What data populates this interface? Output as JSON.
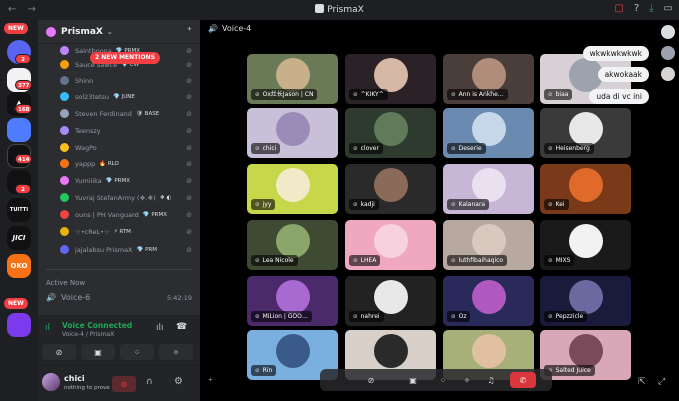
{
  "titlebar": {
    "title": "PrismaX",
    "nav": "← →",
    "ctrl_icons": [
      "▢",
      "?",
      "⤓",
      "▭"
    ]
  },
  "rail": {
    "badges": [
      {
        "type": "new",
        "text": "NEW"
      },
      {
        "type": "count",
        "text": "2"
      },
      {
        "type": "count",
        "text": "377"
      },
      {
        "type": "count",
        "text": "168"
      },
      {
        "type": "count",
        "text": "414"
      },
      {
        "type": "count",
        "text": "2"
      },
      {
        "type": "new",
        "text": "NEW"
      }
    ],
    "server_labels": [
      "TUITTI",
      "JICI",
      "OKO"
    ]
  },
  "sidebar": {
    "server_name": "PrismaX",
    "new_mentions": "2 NEW MENTIONS",
    "members": [
      {
        "name": "Saintboona",
        "tag": "💎 PRMX",
        "color": "#c084fc"
      },
      {
        "name": "Sauce sawce",
        "tag": "💎 CW",
        "color": "#f59e0b"
      },
      {
        "name": "Shinn",
        "tag": "",
        "color": "#64748b"
      },
      {
        "name": "sol23tetsu",
        "tag": "💎 JUNE",
        "color": "#38bdf8"
      },
      {
        "name": "Steven Ferdinand",
        "tag": "🛡 BASE",
        "color": "#94a3b8"
      },
      {
        "name": "Teenszy",
        "tag": "",
        "color": "#a78bfa"
      },
      {
        "name": "WagPo",
        "tag": "",
        "color": "#fbbf24"
      },
      {
        "name": "yappp",
        "tag": "🔥 RLO",
        "color": "#f97316"
      },
      {
        "name": "Yumiiika",
        "tag": "💎 PRMX",
        "color": "#e879f9"
      },
      {
        "name": "Yuvraj StefanArmy (❖,❖)",
        "tag": "❖ ◐",
        "color": "#22c55e"
      },
      {
        "name": "ouns | PH Vanguard",
        "tag": "💎 PRMX",
        "color": "#ef4444"
      },
      {
        "name": "☆•cReL•☆",
        "tag": "⚡ RTM",
        "color": "#eab308"
      },
      {
        "name": "jajalabsu PrismaX",
        "tag": "💎 PRM",
        "color": "#6366f1"
      }
    ],
    "active_now": "Active Now",
    "voice_channel": "Voice-6",
    "voice_time": "5:42:19"
  },
  "voice_panel": {
    "title": "Voice Connected",
    "subtitle": "Voice-4 / PrismaX",
    "buttons": [
      "⊘",
      "▣",
      "⁘",
      "✧"
    ]
  },
  "user": {
    "name": "chici",
    "status": "nothing to prove"
  },
  "main": {
    "channel": "Voice-4",
    "tiles": [
      {
        "label": "Ox灶长Jason | CN",
        "bg": "#6b7a56",
        "pic": "#c7b08a"
      },
      {
        "label": "^KIKY^",
        "bg": "#2a2226",
        "pic": "#d6b8a6"
      },
      {
        "label": "Ann is Ankhe…",
        "bg": "#4a3e3a",
        "pic": "#b08d7a"
      },
      {
        "label": "biaa",
        "bg": "#d7d0d4",
        "pic": "#9ca3af"
      },
      {
        "label": "chici",
        "bg": "#c8bfd8",
        "pic": "#9b8bb8"
      },
      {
        "label": "clover",
        "bg": "#2f3a2f",
        "pic": "#5f7b5a"
      },
      {
        "label": "Deserie",
        "bg": "#6a8ab0",
        "pic": "#c7d7ea"
      },
      {
        "label": "Heisenberg",
        "bg": "#3a3a3a",
        "pic": "#e8e8e8"
      },
      {
        "label": "jyy",
        "bg": "#c6d74a",
        "pic": "#f2e9c9"
      },
      {
        "label": "kadji",
        "bg": "#2a2a2a",
        "pic": "#8b6a5a"
      },
      {
        "label": "Kalanara",
        "bg": "#c8b6d6",
        "pic": "#e9e1f0"
      },
      {
        "label": "Kei",
        "bg": "#7a3a1a",
        "pic": "#e06a2a"
      },
      {
        "label": "Lea Nicole",
        "bg": "#3f4a32",
        "pic": "#8aa66a"
      },
      {
        "label": "LHEA",
        "bg": "#f0a8c0",
        "pic": "#f7d2de"
      },
      {
        "label": "luthfibaihaqico",
        "bg": "#b7a8a0",
        "pic": "#d8c8be"
      },
      {
        "label": "MIXS",
        "bg": "#1a1a1a",
        "pic": "#f2f2f2"
      },
      {
        "label": "MiLion | GOO…",
        "bg": "#4a2a6a",
        "pic": "#a86ad0"
      },
      {
        "label": "nahrei",
        "bg": "#222222",
        "pic": "#e8e8e8"
      },
      {
        "label": "Oz",
        "bg": "#2a2a5a",
        "pic": "#b05ac0"
      },
      {
        "label": "Pepzzicle",
        "bg": "#1a1a3a",
        "pic": "#6a6aa0"
      },
      {
        "label": "Rin",
        "bg": "#7ab0e0",
        "pic": "#3a5a8a"
      },
      {
        "label": "",
        "bg": "#d8d0c8",
        "pic": "#2a2a2a"
      },
      {
        "label": "",
        "bg": "#a8b07a",
        "pic": "#e0c0a0"
      },
      {
        "label": "Salted Juice",
        "bg": "#d8a8b8",
        "pic": "#7a4a5a"
      }
    ],
    "bubbles": [
      "wkwkwkwkwk",
      "akwokaak",
      "uda di vc ini"
    ],
    "call_buttons": [
      "⊘",
      "▣",
      "⁘",
      "✧",
      "♫",
      "✆"
    ]
  },
  "colors": {
    "accent_green": "#23a559",
    "danger": "#f23f43",
    "bg_dark": "#1e1f22"
  }
}
